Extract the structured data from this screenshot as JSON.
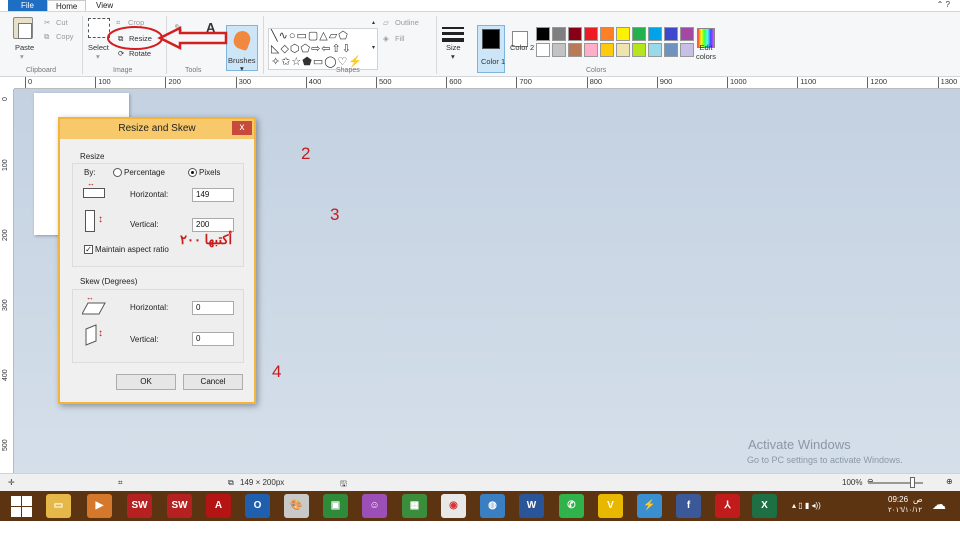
{
  "tabs": {
    "file": "File",
    "home": "Home",
    "view": "View"
  },
  "ribbon": {
    "clipboard": {
      "paste": "Paste",
      "cut": "Cut",
      "copy": "Copy",
      "group": "Clipboard"
    },
    "image": {
      "select": "Select",
      "crop": "Crop",
      "resize": "Resize",
      "rotate": "Rotate",
      "group": "Image"
    },
    "tools": {
      "group": "Tools",
      "text_tool": "A"
    },
    "brushes": "Brushes",
    "shapes": {
      "outline": "Outline",
      "fill": "Fill",
      "group": "Shapes"
    },
    "size": "Size",
    "color1": "Color 1",
    "color2": "Color 2",
    "colors_group": "Colors",
    "edit_colors": "Edit colors",
    "palette": [
      "#000000",
      "#7f7f7f",
      "#880015",
      "#ed1c24",
      "#ff7f27",
      "#fff200",
      "#22b14c",
      "#00a2e8",
      "#3f48cc",
      "#a349a4",
      "#ffffff",
      "#c3c3c3",
      "#b97a57",
      "#ffaec9",
      "#ffc90e",
      "#efe4b0",
      "#b5e61d",
      "#99d9ea",
      "#7092be",
      "#c8bfe7"
    ]
  },
  "ruler": {
    "h": [
      "0",
      "100",
      "200",
      "300",
      "400",
      "500",
      "600",
      "700",
      "800",
      "900",
      "1000",
      "1100",
      "1200",
      "1300"
    ],
    "v": [
      "0",
      "100",
      "200",
      "300",
      "400",
      "500"
    ]
  },
  "dialog": {
    "title": "Resize and Skew",
    "close": "x",
    "resize": {
      "legend": "Resize",
      "by": "By:",
      "percentage": "Percentage",
      "pixels": "Pixels",
      "horizontal_label": "Horizontal:",
      "horizontal_value": "149",
      "vertical_label": "Vertical:",
      "vertical_value": "200",
      "maintain": "Maintain aspect ratio"
    },
    "skew": {
      "legend": "Skew (Degrees)",
      "horizontal_label": "Horizontal:",
      "horizontal_value": "0",
      "vertical_label": "Vertical:",
      "vertical_value": "0"
    },
    "ok": "OK",
    "cancel": "Cancel"
  },
  "annotations": {
    "n2": "2",
    "n3": "3",
    "n4": "4",
    "arabic": "أكتبها ٢٠٠"
  },
  "status": {
    "size": "149 × 200px",
    "zoom": "100%"
  },
  "watermark": {
    "line1": "Activate Windows",
    "line2": "Go to PC settings to activate Windows."
  },
  "taskbar": {
    "time": "09:26",
    "ampm": "ص",
    "date": "٢٠١٦/١٠/١٢"
  }
}
